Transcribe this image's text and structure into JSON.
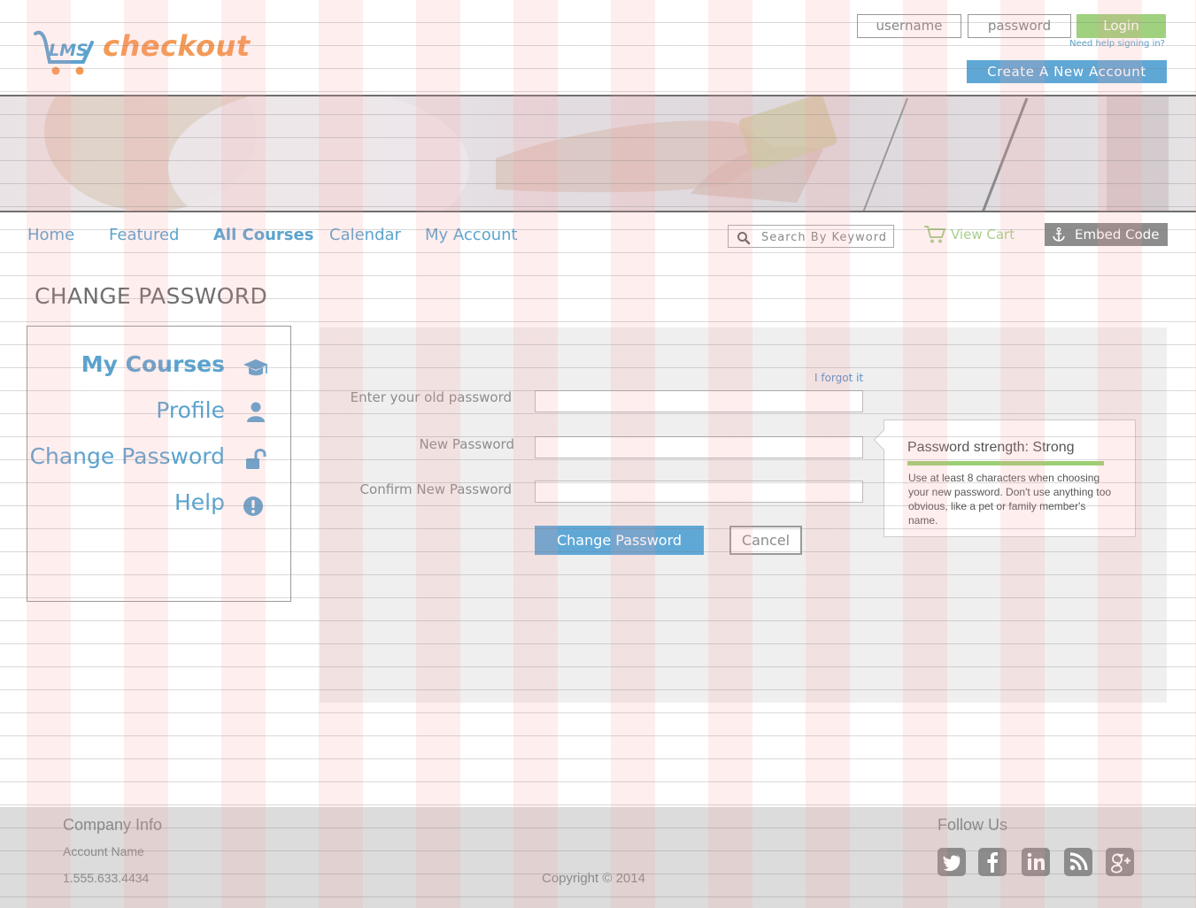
{
  "header": {
    "logo_text": "checkout",
    "logo_mark_text": "LMS",
    "username_placeholder": "username",
    "password_placeholder": "password",
    "login_label": "Login",
    "help_link": "Need help signing in?",
    "create_account_label": "Create  A  New  Account"
  },
  "nav": {
    "items": [
      {
        "label": "Home"
      },
      {
        "label": "Featured"
      },
      {
        "label": "All Courses"
      },
      {
        "label": "Calendar"
      },
      {
        "label": "My Account"
      }
    ],
    "active_item": "All Courses",
    "search_placeholder": "Search By Keyword",
    "view_cart_label": "View Cart",
    "embed_code_label": "Embed Code"
  },
  "page": {
    "title": "CHANGE PASSWORD"
  },
  "sidebar": {
    "items": [
      {
        "label": "My Courses",
        "icon": "graduation-cap-icon"
      },
      {
        "label": "Profile",
        "icon": "user-icon"
      },
      {
        "label": "Change Password",
        "icon": "unlock-icon"
      },
      {
        "label": "Help",
        "icon": "exclamation-circle-icon"
      }
    ],
    "active_item": "My Courses"
  },
  "form": {
    "forgot_link": "I forgot it",
    "old_password_label": "Enter your old password",
    "new_password_label": "New Password",
    "confirm_password_label": "Confirm New Password",
    "old_password_value": "",
    "new_password_value": "",
    "confirm_password_value": "",
    "change_button_label": "Change Password",
    "cancel_button_label": "Cancel"
  },
  "strength": {
    "title": "Password strength: Strong",
    "level_percent": 100,
    "hint": "Use at least 8 characters when choosing your new password.  Don't use anything too obvious, like a pet or family member's name."
  },
  "footer": {
    "company_heading": "Company Info",
    "account_name": "Account Name",
    "phone": "1.555.633.4434",
    "copyright": "Copyright © 2014",
    "follow_heading": "Follow Us",
    "social_icons": [
      "twitter-icon",
      "facebook-icon",
      "linkedin-icon",
      "rss-icon",
      "google-plus-icon"
    ]
  },
  "colors": {
    "accent_blue": "#5fa8d6",
    "link_blue": "#5ba3cf",
    "login_green": "#9fd17f",
    "logo_orange": "#f39a56",
    "strength_green": "#9bcf74"
  }
}
